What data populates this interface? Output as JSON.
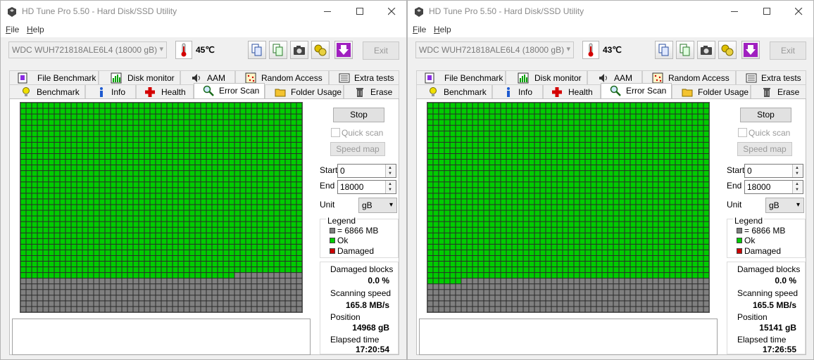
{
  "legend_colors": {
    "unit": "#808080",
    "ok": "#00cc00",
    "damaged": "#cc0000"
  },
  "windows": [
    {
      "title": "HD Tune Pro 5.50 - Hard Disk/SSD Utility",
      "menu": {
        "file": "ile",
        "file_u": "F",
        "help": "elp",
        "help_u": "H"
      },
      "drive": "WDC  WUH721818ALE6L4 (18000 gB)",
      "temperature": "45℃",
      "exit_label": "Exit",
      "tabs_top": [
        "File Benchmark",
        "Disk monitor",
        "AAM",
        "Random Access",
        "Extra tests"
      ],
      "tabs_bottom": [
        "Benchmark",
        "Info",
        "Health",
        "Error Scan",
        "Folder Usage",
        "Erase"
      ],
      "active_tab": "Error Scan",
      "stop_label": "Stop",
      "quick_scan_label": "Quick scan",
      "speed_map_label": "Speed map",
      "start_label": "Start",
      "start_value": "0",
      "end_label": "End",
      "end_value": "18000",
      "unit_label": "Unit",
      "unit_value": "gB",
      "legend_title": "Legend",
      "legend_block": "= 6866 MB",
      "legend_ok": "Ok",
      "legend_damaged": "Damaged",
      "damaged_blocks_label": "Damaged blocks",
      "damaged_blocks_value": "0.0 %",
      "scanning_speed_label": "Scanning speed",
      "scanning_speed_value": "165.8 MB/s",
      "position_label": "Position",
      "position_value": "14968 gB",
      "elapsed_label": "Elapsed time",
      "elapsed_value": "17:20:54",
      "scan_progress": 0.8316
    },
    {
      "title": "HD Tune Pro 5.50 - Hard Disk/SSD Utility",
      "menu": {
        "file": "ile",
        "file_u": "F",
        "help": "elp",
        "help_u": "H"
      },
      "drive": "WDC  WUH721818ALE6L4 (18000 gB)",
      "temperature": "43℃",
      "exit_label": "Exit",
      "tabs_top": [
        "File Benchmark",
        "Disk monitor",
        "AAM",
        "Random Access",
        "Extra tests"
      ],
      "tabs_bottom": [
        "Benchmark",
        "Info",
        "Health",
        "Error Scan",
        "Folder Usage",
        "Erase"
      ],
      "active_tab": "Error Scan",
      "stop_label": "Stop",
      "quick_scan_label": "Quick scan",
      "speed_map_label": "Speed map",
      "start_label": "Start",
      "start_value": "0",
      "end_label": "End",
      "end_value": "18000",
      "unit_label": "Unit",
      "unit_value": "gB",
      "legend_title": "Legend",
      "legend_block": "= 6866 MB",
      "legend_ok": "Ok",
      "legend_damaged": "Damaged",
      "damaged_blocks_label": "Damaged blocks",
      "damaged_blocks_value": "0.0 %",
      "scanning_speed_label": "Scanning speed",
      "scanning_speed_value": "165.5 MB/s",
      "position_label": "Position",
      "position_value": "15141 gB",
      "elapsed_label": "Elapsed time",
      "elapsed_value": "17:26:55",
      "scan_progress": 0.8412
    }
  ]
}
